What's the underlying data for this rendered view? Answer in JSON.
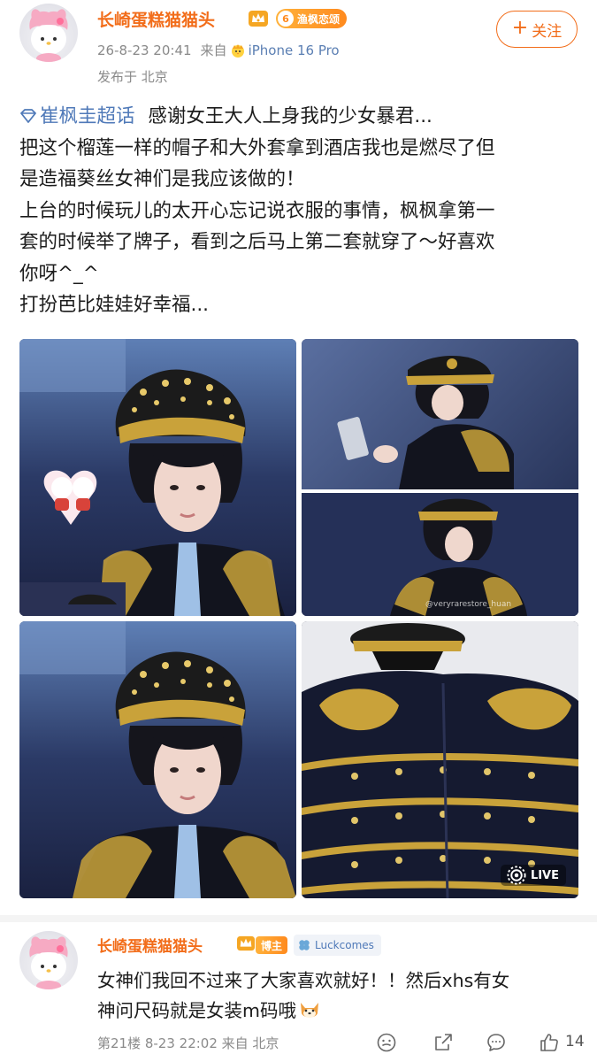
{
  "post": {
    "username": "长崎蛋糕猫猫头",
    "level_number": "6",
    "level_label": "渔枫恋颂",
    "timestamp": "26-8-23 20:41",
    "from_label": "来自",
    "device": "iPhone 16 Pro",
    "location": "发布于 北京",
    "follow_label": "关注",
    "topic": "崔枫圭超话",
    "body_lines": [
      "感谢女王大人上身我的少女暴君...",
      "把这个榴莲一样的帽子和大外套拿到酒店我也是燃尽了但",
      "是造福葵丝女神们是我应该做的！",
      "上台的时候玩儿的太开心忘记说衣服的事情，枫枫拿第一",
      "套的时候举了牌子，看到之后马上第二套就穿了～好喜欢",
      "你呀^_^",
      "打扮芭比娃娃好幸福..."
    ],
    "photo_watermark": "@veryrarestore_huan",
    "live_label": "LIVE"
  },
  "reply": {
    "username": "长崎蛋糕猫猫头",
    "badge_label": "博主",
    "luck_label": "Luckcomes",
    "text_lines": [
      "女神们我回不过来了大家喜欢就好！！然后xhs有女",
      "神问尺码就是女装m码哦"
    ],
    "floor_meta": "第21楼  8-23 22:02  来自 北京",
    "like_count": "14"
  },
  "colors": {
    "accent_orange": "#f26d1a",
    "link_blue": "#4f79b8",
    "meta_gray": "#8a8a8a",
    "gold": "#c9a23a",
    "navy": "#1a2140"
  },
  "icons": [
    "crown-icon",
    "chick-icon",
    "topic-diamond-icon",
    "live-icon",
    "clover-icon",
    "shiba-emoji-icon",
    "emoji-face-icon",
    "share-icon",
    "comment-icon",
    "like-icon"
  ]
}
